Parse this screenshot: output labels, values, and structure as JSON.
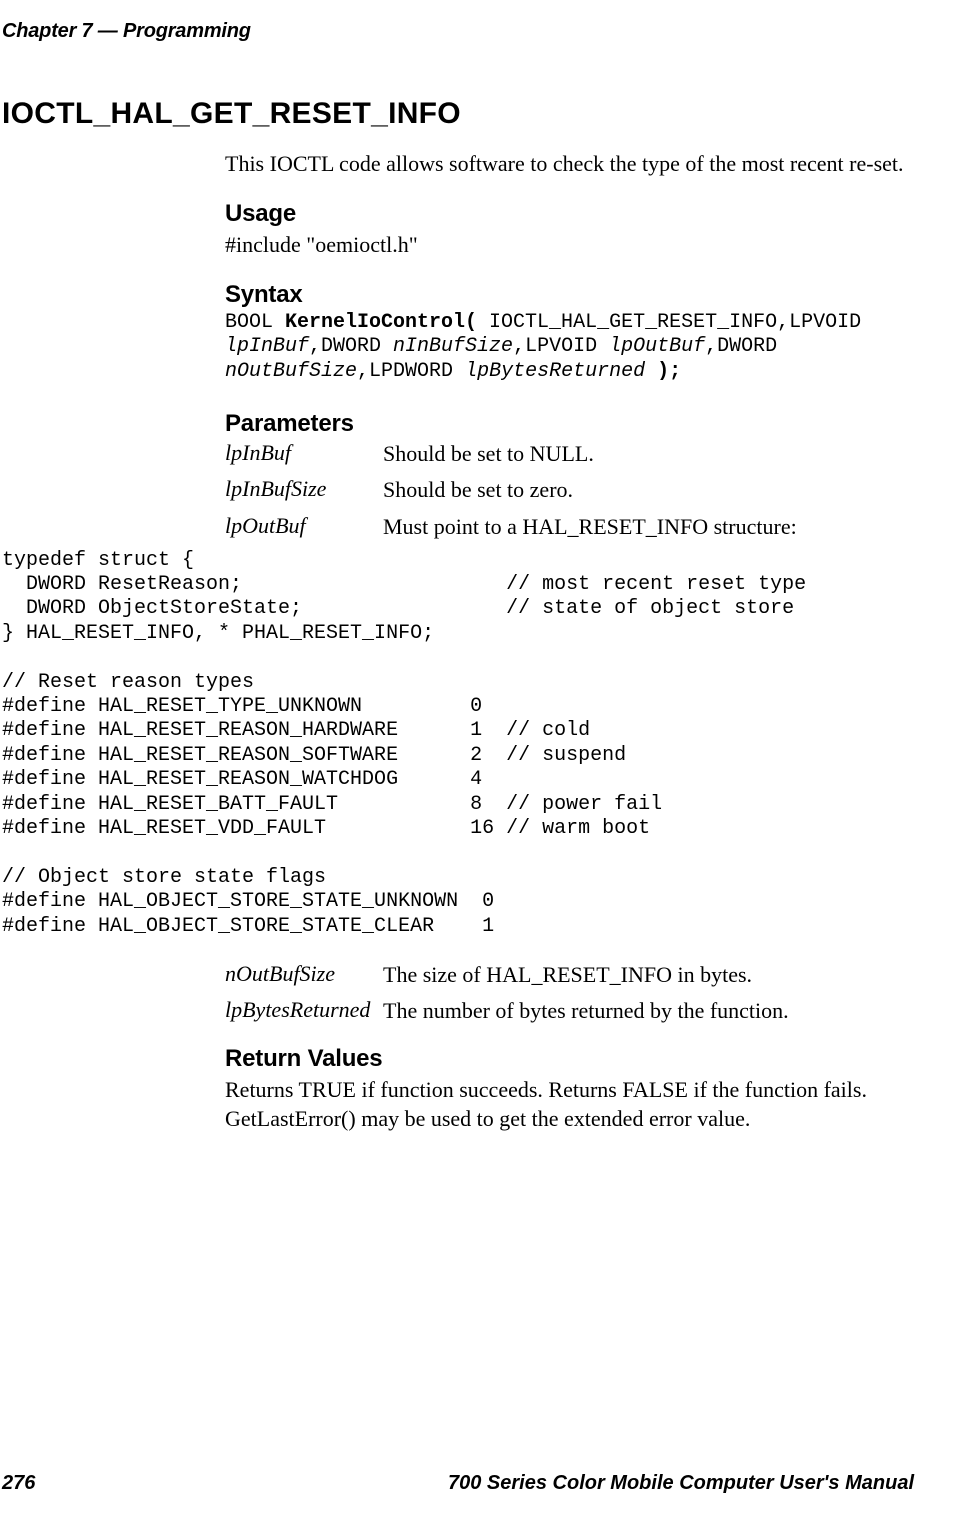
{
  "header": {
    "chapter_label": "Chapter 7",
    "dash": " — ",
    "chapter_title": "Programming"
  },
  "title": "IOCTL_HAL_GET_RESET_INFO",
  "intro": "This IOCTL code allows software to check the type of the most recent re-set.",
  "usage": {
    "heading": "Usage",
    "line": "#include \"oemioctl.h\""
  },
  "syntax": {
    "heading": "Syntax",
    "line1_prefix": "BOOL ",
    "line1_bold": "KernelIoControl(",
    "line1_suffix": " IOCTL_HAL_GET_RESET_INFO,LPVOID",
    "line2_it1": "lpInBuf",
    "line2_mid1": ",DWORD ",
    "line2_it2": "nInBufSize",
    "line2_mid2": ",LPVOID ",
    "line2_it3": "lpOutBuf",
    "line2_suffix": ",DWORD",
    "line3_it1": "nOutBufSize",
    "line3_mid": ",LPDWORD ",
    "line3_it2": "lpBytesReturned",
    "line3_suffix": " );"
  },
  "parameters": {
    "heading": "Parameters",
    "rows1": [
      {
        "name": "lpInBuf",
        "desc": "Should be set to NULL."
      },
      {
        "name": "lpInBufSize",
        "desc": "Should be set to zero."
      },
      {
        "name": "lpOutBuf",
        "desc": "Must point to a HAL_RESET_INFO structure:"
      }
    ],
    "code": "typedef struct {\n  DWORD ResetReason;                      // most recent reset type\n  DWORD ObjectStoreState;                 // state of object store\n} HAL_RESET_INFO, * PHAL_RESET_INFO;\n\n// Reset reason types\n#define HAL_RESET_TYPE_UNKNOWN         0\n#define HAL_RESET_REASON_HARDWARE      1  // cold\n#define HAL_RESET_REASON_SOFTWARE      2  // suspend\n#define HAL_RESET_REASON_WATCHDOG      4\n#define HAL_RESET_BATT_FAULT           8  // power fail\n#define HAL_RESET_VDD_FAULT            16 // warm boot\n\n// Object store state flags\n#define HAL_OBJECT_STORE_STATE_UNKNOWN  0\n#define HAL_OBJECT_STORE_STATE_CLEAR    1",
    "rows2": [
      {
        "name": "nOutBufSize",
        "desc": "The size of HAL_RESET_INFO in bytes."
      },
      {
        "name": "lpBytesReturned",
        "desc": "The number of bytes returned by the function."
      }
    ]
  },
  "return": {
    "heading": "Return Values",
    "body": "Returns TRUE if function succeeds. Returns FALSE if the function fails. GetLastError() may be used to get the extended error value."
  },
  "footer": {
    "page_number": "276",
    "manual_title": "700 Series Color Mobile Computer User's Manual"
  }
}
